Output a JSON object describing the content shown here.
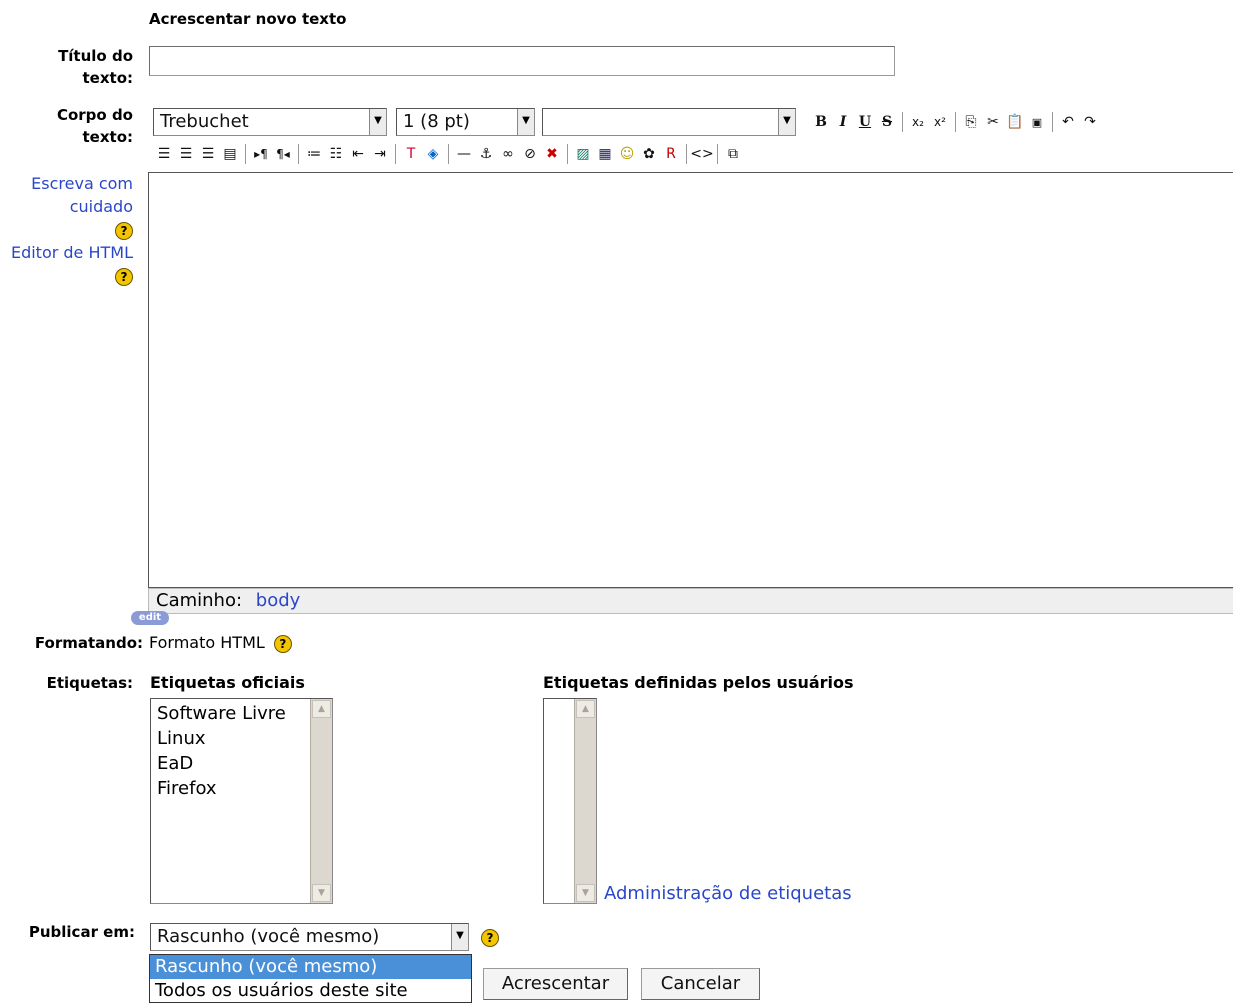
{
  "form": {
    "heading": "Acrescentar novo texto",
    "title_label": "Título do texto:",
    "body_label": "Corpo do texto:",
    "help_links": [
      "Escreva com cuidado",
      "Editor de HTML"
    ],
    "format_label": "Formatando:",
    "format_value": "Formato HTML",
    "tags_label": "Etiquetas:",
    "publish_label": "Publicar em:"
  },
  "editor": {
    "font": "Trebuchet",
    "size": "1 (8 pt)",
    "style": "",
    "path_label": "Caminho:",
    "path_value": "body",
    "edit_badge": "edit",
    "toolbar_icons": [
      "bold",
      "italic",
      "underline",
      "strikethrough",
      "subscript",
      "superscript",
      "copy",
      "cut",
      "paste",
      "paste-word",
      "undo",
      "redo",
      "align-left",
      "align-center",
      "align-right",
      "justify",
      "ltr",
      "rtl",
      "ordered-list",
      "unordered-list",
      "outdent",
      "indent",
      "text-color",
      "bg-color",
      "horizontal-rule",
      "anchor",
      "link",
      "unlink",
      "nolink",
      "image",
      "table",
      "smiley",
      "special-char",
      "search-replace",
      "html-source",
      "fullscreen"
    ]
  },
  "tags": {
    "official_title": "Etiquetas oficiais",
    "official": [
      "Software Livre",
      "Linux",
      "EaD",
      "Firefox"
    ],
    "user_title": "Etiquetas definidas pelos usuários",
    "admin_link": "Administração de etiquetas"
  },
  "publish": {
    "selected": "Rascunho (você mesmo)",
    "options": [
      "Rascunho (você mesmo)",
      "Todos os usuários deste site"
    ]
  },
  "buttons": {
    "submit": "Acrescentar",
    "cancel": "Cancelar"
  },
  "colors": {
    "link": "#2b47c9",
    "highlight": "#4a90d9",
    "help_icon": "#f3c500"
  }
}
